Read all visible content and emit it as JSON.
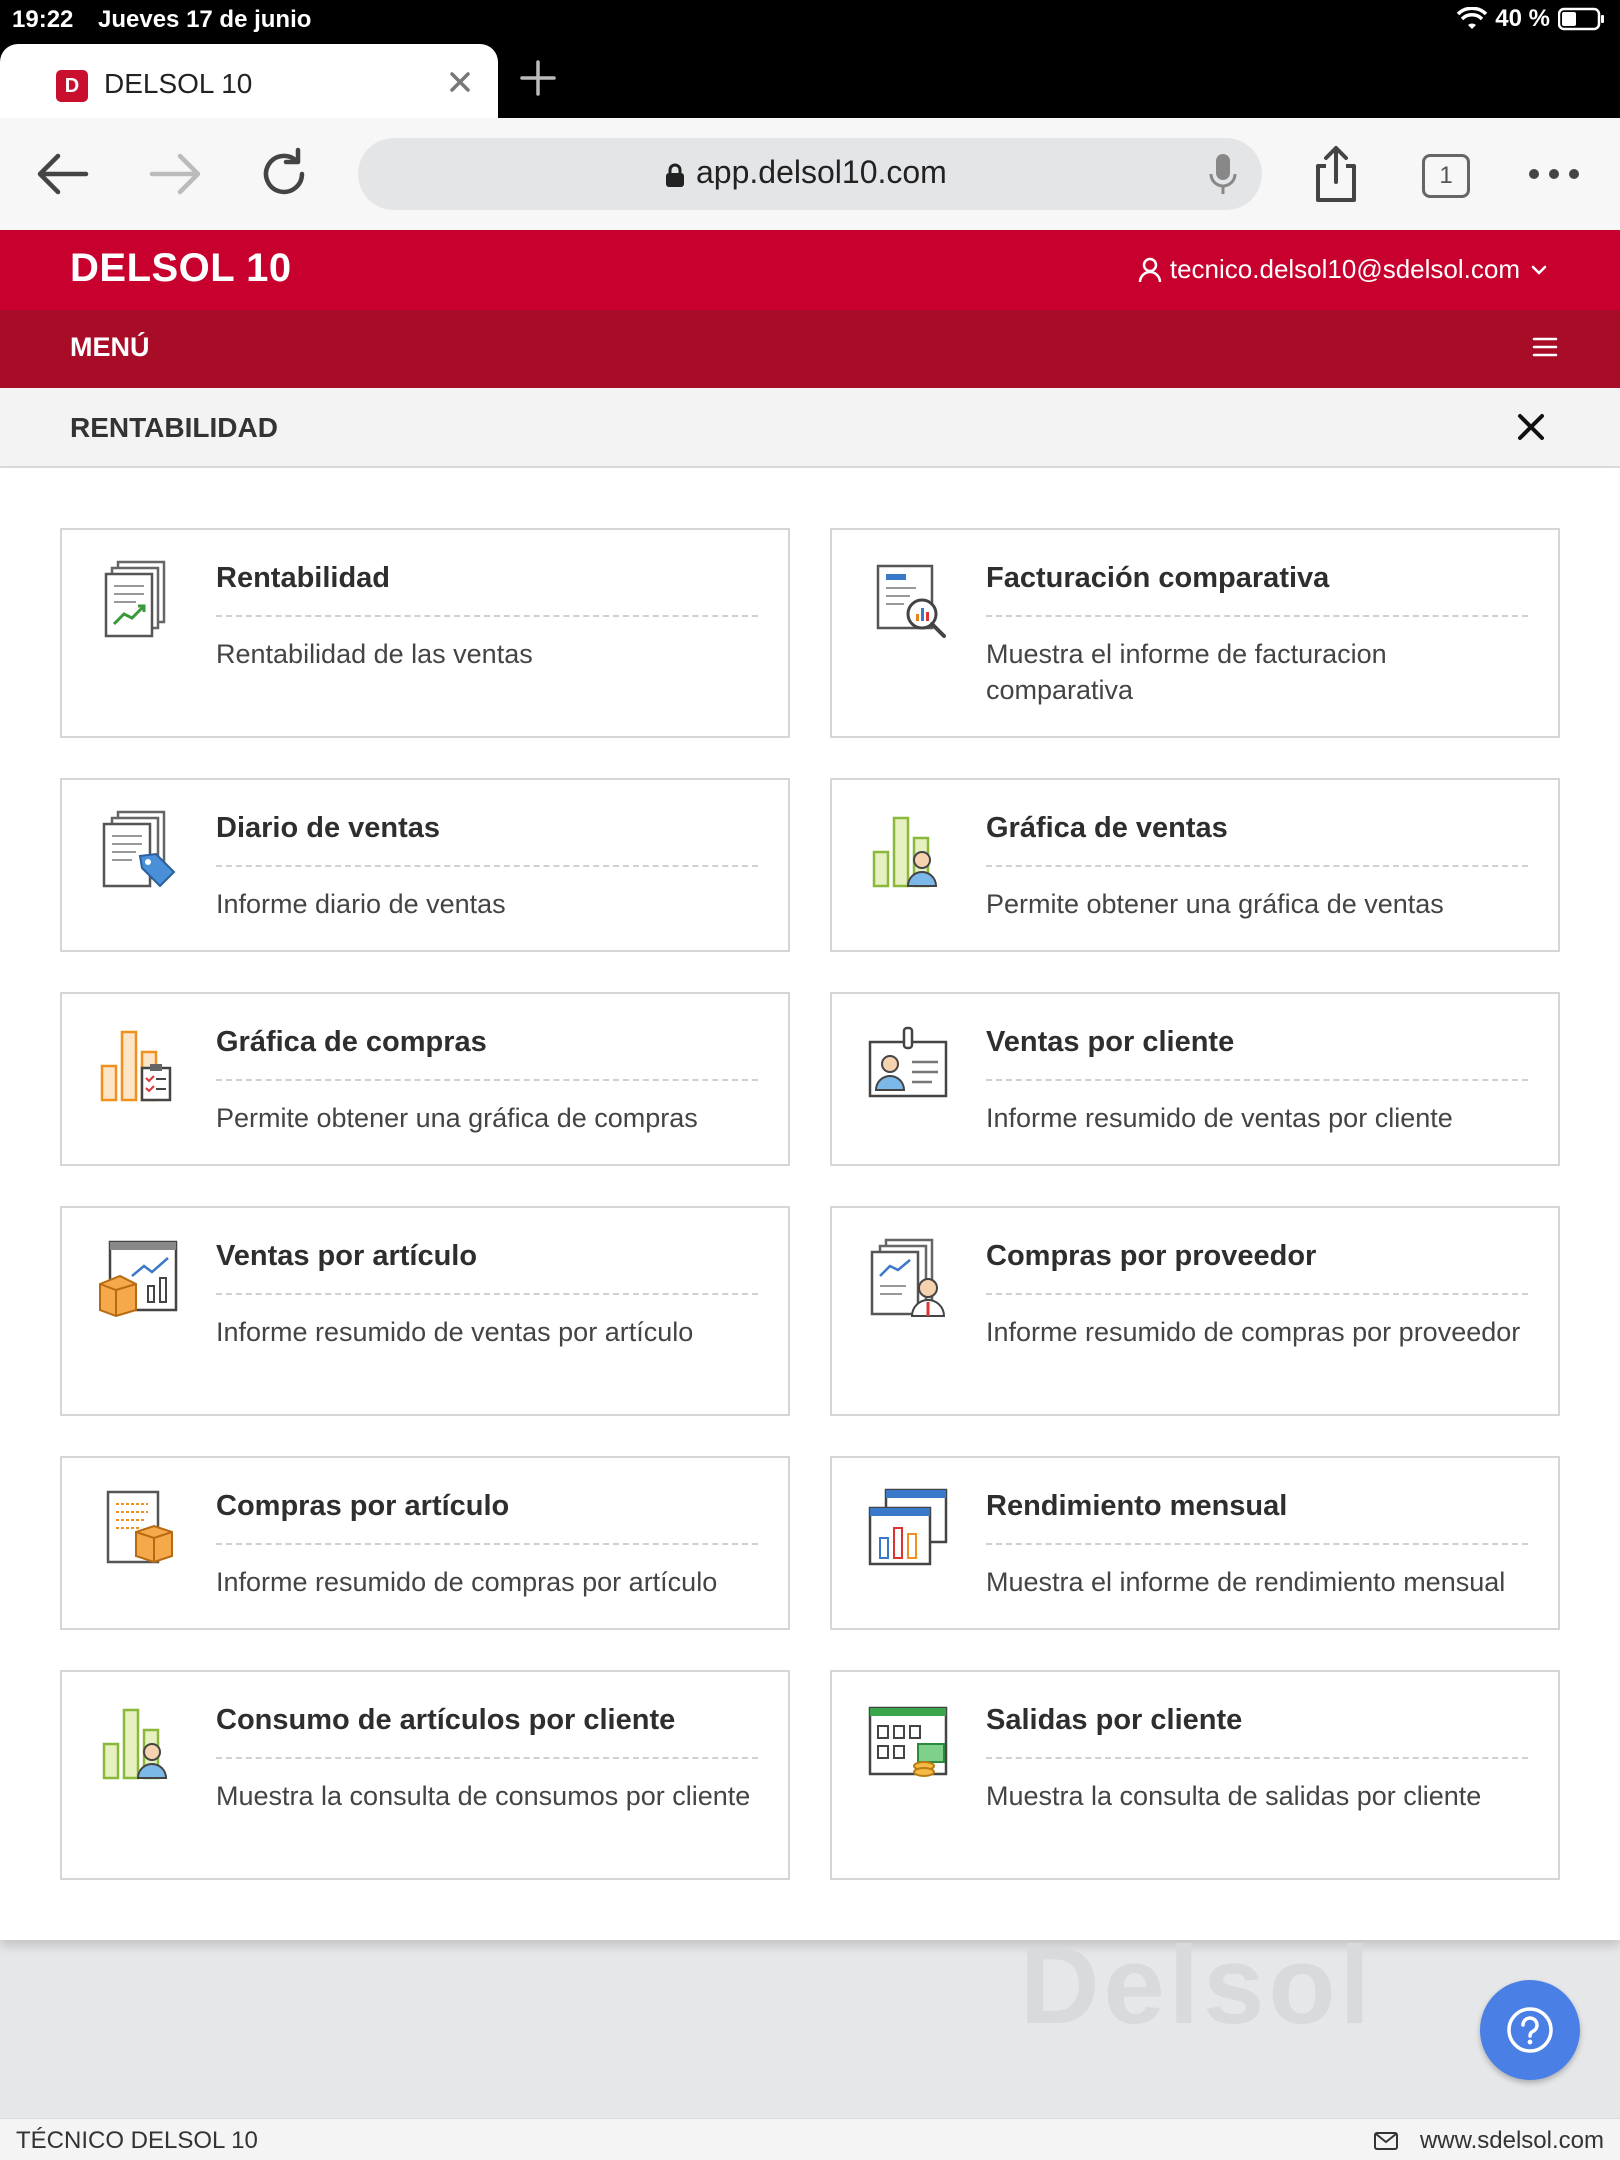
{
  "status": {
    "time": "19:22",
    "date": "Jueves 17 de junio",
    "battery": "40 %"
  },
  "browser": {
    "tab_title": "DELSOL 10",
    "favicon_text": "D",
    "url": "app.delsol10.com",
    "tab_count": "1"
  },
  "app": {
    "brand": "DELSOL 10",
    "user_email": "tecnico.delsol10@sdelsol.com",
    "menu_label": "MENÚ",
    "section_title": "RENTABILIDAD"
  },
  "cards": [
    {
      "title": "Rentabilidad",
      "desc": "Rentabilidad de las ventas",
      "icon": "report-trend-icon"
    },
    {
      "title": "Facturación comparativa",
      "desc": "Muestra el informe de facturacion comparativa",
      "icon": "report-magnifier-icon"
    },
    {
      "title": "Diario de ventas",
      "desc": "Informe diario de ventas",
      "icon": "report-tag-icon"
    },
    {
      "title": "Gráfica de ventas",
      "desc": "Permite obtener una gráfica de ventas",
      "icon": "bar-chart-person-icon"
    },
    {
      "title": "Gráfica de compras",
      "desc": "Permite obtener una gráfica de compras",
      "icon": "bar-chart-clipboard-icon"
    },
    {
      "title": "Ventas por cliente",
      "desc": "Informe resumido de ventas por cliente",
      "icon": "id-card-icon"
    },
    {
      "title": "Ventas por artículo",
      "desc": "Informe resumido de ventas por artículo",
      "icon": "window-chart-box-icon"
    },
    {
      "title": "Compras por proveedor",
      "desc": "Informe resumido de compras por proveedor",
      "icon": "report-person-icon"
    },
    {
      "title": "Compras por artículo",
      "desc": "Informe resumido de compras por artículo",
      "icon": "report-box-icon"
    },
    {
      "title": "Rendimiento mensual",
      "desc": "Muestra el informe de rendimiento mensual",
      "icon": "window-bars-icon"
    },
    {
      "title": "Consumo de artículos por cliente",
      "desc": "Muestra la consulta de consumos por cliente",
      "icon": "bar-chart-person-icon"
    },
    {
      "title": "Salidas por cliente",
      "desc": "Muestra la consulta de salidas por cliente",
      "icon": "grid-coins-icon"
    }
  ],
  "watermark": "Delsol",
  "footer": {
    "left": "TÉCNICO DELSOL 10",
    "site": "www.sdelsol.com"
  },
  "colors": {
    "brand_red": "#c8002e",
    "menu_red": "#a80c26",
    "help_blue": "#4a7fe6"
  }
}
